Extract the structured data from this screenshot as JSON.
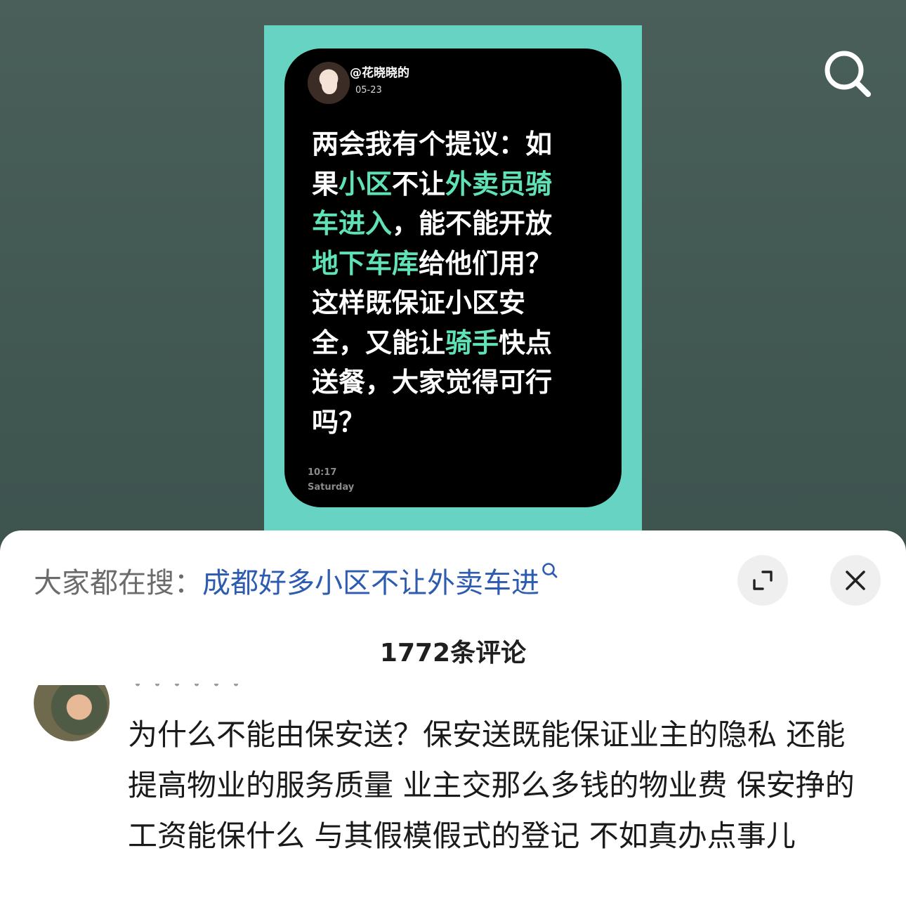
{
  "post_card": {
    "username": "@花晓晓的",
    "date": "05-23",
    "text_segments": [
      {
        "text": "两会我有个提议：如果",
        "highlight": false
      },
      {
        "text": "小区",
        "highlight": true
      },
      {
        "text": "不让",
        "highlight": false
      },
      {
        "text": "外卖员骑车进入",
        "highlight": true
      },
      {
        "text": "，能不能开放",
        "highlight": false
      },
      {
        "text": "地下车库",
        "highlight": true
      },
      {
        "text": "给他们用？这样既保证小区安全，又能让",
        "highlight": false
      },
      {
        "text": "骑手",
        "highlight": true
      },
      {
        "text": "快点送餐，大家觉得可行吗？",
        "highlight": false
      }
    ],
    "time": "10:17",
    "day": "Saturday",
    "colors": {
      "poster_bg": "#67d3c2",
      "card_bg": "#000000",
      "highlight": "#5fe3b6"
    }
  },
  "top_bar": {
    "search_icon": "search-icon"
  },
  "sheet": {
    "search_prefix": "大家都在搜：",
    "search_query": "成都好多小区不让外卖车进",
    "expand_icon": "expand-icon",
    "close_icon": "close-icon",
    "comment_count": "1772条评论"
  },
  "comment": {
    "text": "为什么不能由保安送？保安送既能保证业主的隐私 还能提高物业的服务质量 业主交那么多钱的物业费 保安挣的工资能保什么 与其假模假式的登记 不如真办点事儿"
  }
}
